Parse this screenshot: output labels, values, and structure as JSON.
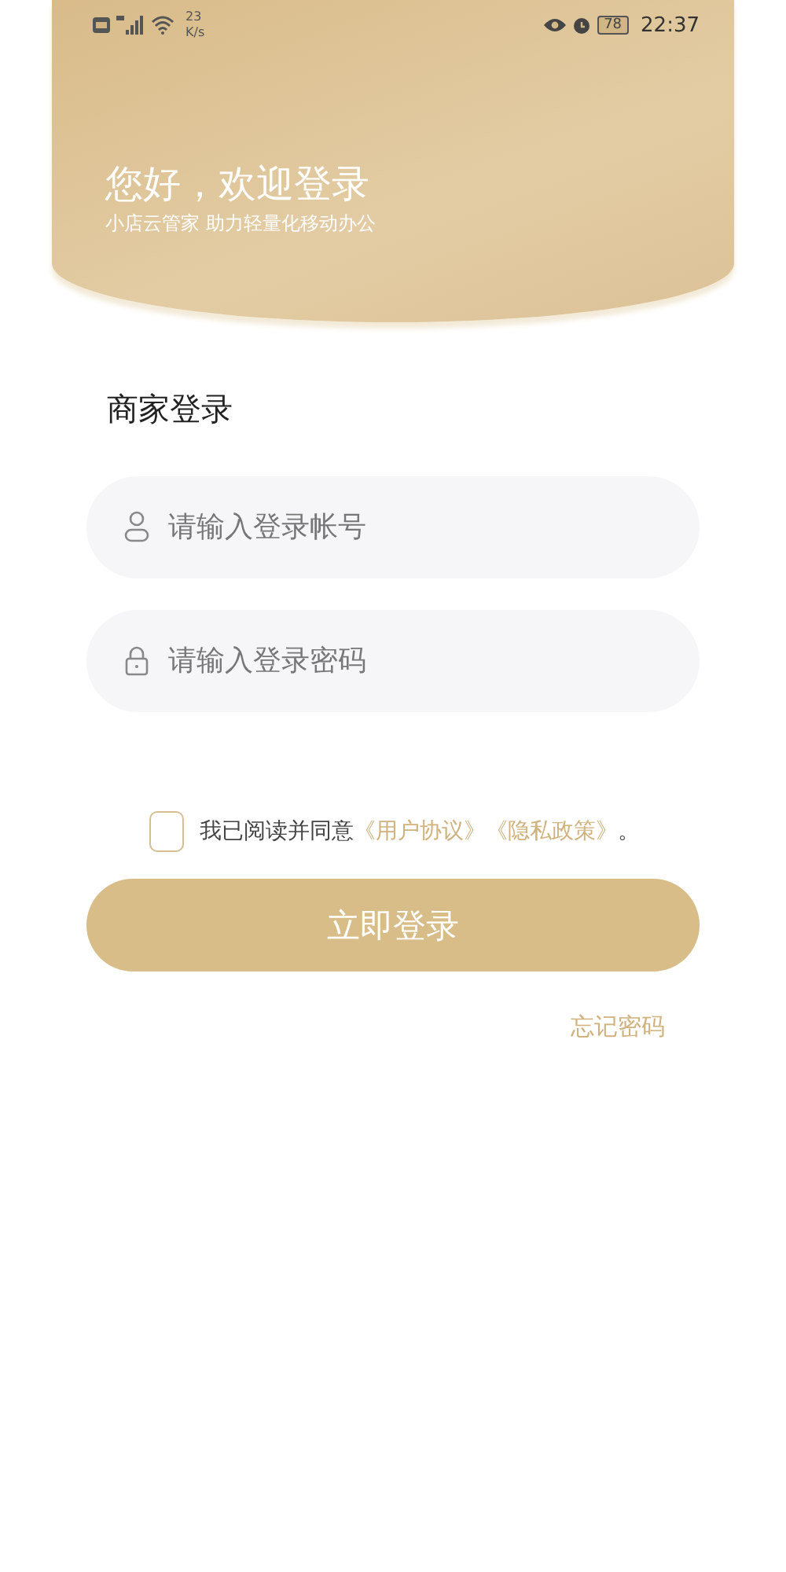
{
  "status_bar": {
    "net_speed": "23",
    "net_speed_unit": "K/s",
    "battery": "78",
    "time": "22:37"
  },
  "header": {
    "title": "您好，欢迎登录",
    "subtitle": "小店云管家 助力轻量化移动办公"
  },
  "form": {
    "heading": "商家登录",
    "fields": [
      {
        "kind": "account",
        "placeholder": "请输入登录帐号"
      },
      {
        "kind": "password",
        "placeholder": "请输入登录密码"
      }
    ],
    "agreement": {
      "checked": false,
      "text": "我已阅读并同意",
      "links": [
        "《用户协议》",
        "《隐私政策》"
      ],
      "end": "。"
    },
    "submit": "立即登录",
    "forgot": "忘记密码"
  }
}
